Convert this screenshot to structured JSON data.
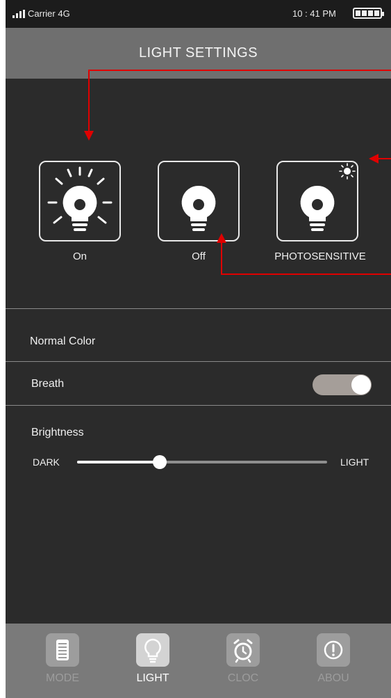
{
  "status": {
    "carrier": "Carrier",
    "network": "4G",
    "time": "10 : 41 PM"
  },
  "header": {
    "title": "LIGHT SETTINGS"
  },
  "modes": [
    {
      "label": "On",
      "icon": "bulb-on-icon"
    },
    {
      "label": "Off",
      "icon": "bulb-off-icon"
    },
    {
      "label": "PHOTOSENSITIVE",
      "icon": "bulb-photosensitive-icon"
    }
  ],
  "settings": {
    "normal_color": "Normal Color",
    "breath": {
      "label": "Breath",
      "enabled": true
    },
    "brightness": {
      "label": "Brightness",
      "min_label": "DARK",
      "max_label": "LIGHT",
      "level": 0.33
    }
  },
  "tabs": [
    {
      "label": "MODE",
      "icon": "mode-icon",
      "active": false
    },
    {
      "label": "LIGHT",
      "icon": "lightbulb-icon",
      "active": true
    },
    {
      "label": "CLOC",
      "icon": "alarm-clock-icon",
      "active": false
    },
    {
      "label": "ABOU",
      "icon": "info-icon",
      "active": false
    }
  ],
  "colors": {
    "background": "#2b2b2b",
    "header": "#6f6f6f",
    "tabbar": "#7a7a7a",
    "toggle_track": "#a59e99",
    "annotation_arrow": "#e00000"
  }
}
